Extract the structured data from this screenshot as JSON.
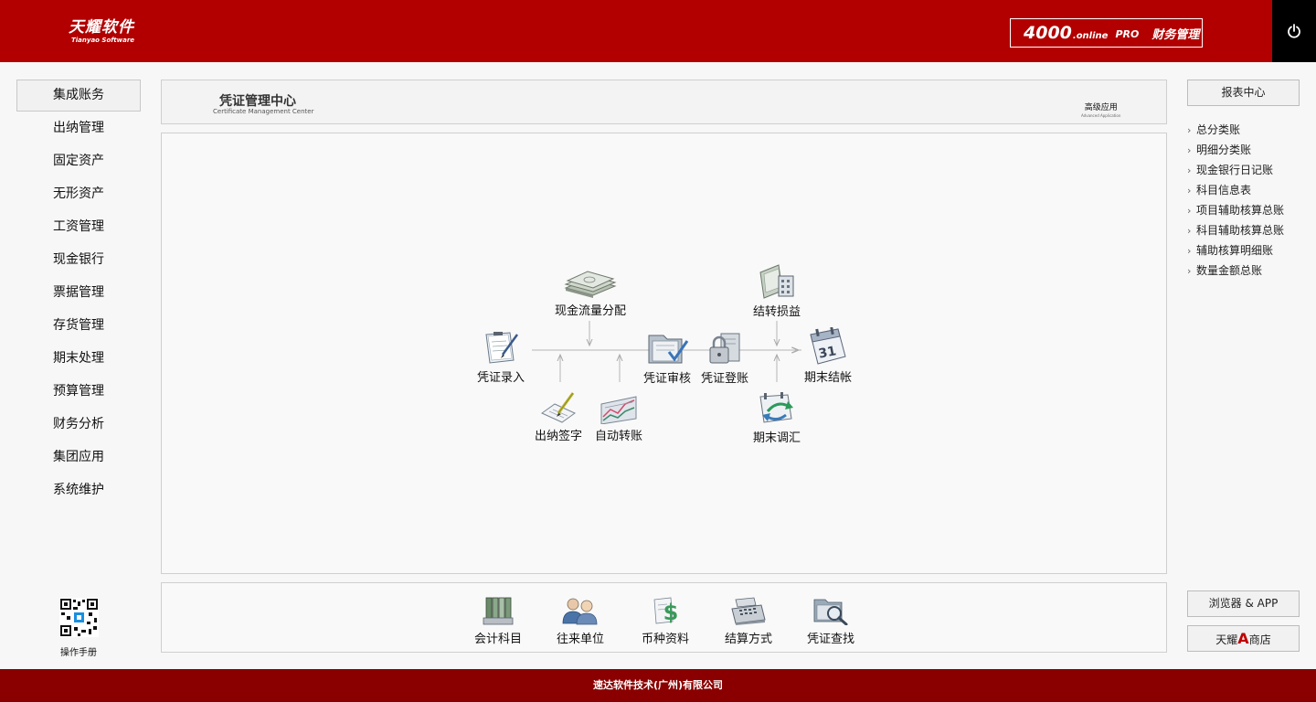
{
  "header": {
    "logo_cn": "天耀软件",
    "logo_en": "Tianyao Software",
    "product_num": "4000",
    "product_online": ".online",
    "product_pro": "PRO",
    "product_name": "财务管理"
  },
  "left_nav": [
    {
      "label": "集成账务",
      "active": true
    },
    {
      "label": "出纳管理"
    },
    {
      "label": "固定资产"
    },
    {
      "label": "无形资产"
    },
    {
      "label": "工资管理"
    },
    {
      "label": "现金银行"
    },
    {
      "label": "票据管理"
    },
    {
      "label": "存货管理"
    },
    {
      "label": "期末处理"
    },
    {
      "label": "预算管理"
    },
    {
      "label": "财务分析"
    },
    {
      "label": "集团应用"
    },
    {
      "label": "系统维护"
    }
  ],
  "qr": {
    "label": "操作手册"
  },
  "center": {
    "title": "凭证管理中心",
    "subtitle": "Certificate Management Center",
    "advanced": "高级应用",
    "advanced_en": "Advanced Application"
  },
  "flow": {
    "voucher_entry": "凭证录入",
    "cash_flow": "现金流量分配",
    "cashier_sign": "出纳签字",
    "auto_transfer": "自动转账",
    "voucher_audit": "凭证审核",
    "voucher_post": "凭证登账",
    "carry_profit": "结转损益",
    "period_adjust": "期末调汇",
    "period_close": "期末结帐"
  },
  "tools": [
    {
      "label": "会计科目",
      "icon": "binders-icon"
    },
    {
      "label": "往来单位",
      "icon": "users-icon"
    },
    {
      "label": "币种资料",
      "icon": "currency-icon"
    },
    {
      "label": "结算方式",
      "icon": "cash-register-icon"
    },
    {
      "label": "凭证查找",
      "icon": "folder-search-icon"
    }
  ],
  "right": {
    "report_center": "报表中心",
    "reports": [
      "总分类账",
      "明细分类账",
      "现金银行日记账",
      "科目信息表",
      "项目辅助核算总账",
      "科目辅助核算总账",
      "辅助核算明细账",
      "数量金额总账"
    ],
    "browser_app": "浏览器 & APP",
    "store_pre": "天耀",
    "store_mark": "A",
    "store_post": "商店"
  },
  "footer": {
    "company": "速达软件技术(广州)有限公司"
  },
  "colors": {
    "header": "#b20000",
    "footer": "#8a0000",
    "accent": "#c00000"
  }
}
